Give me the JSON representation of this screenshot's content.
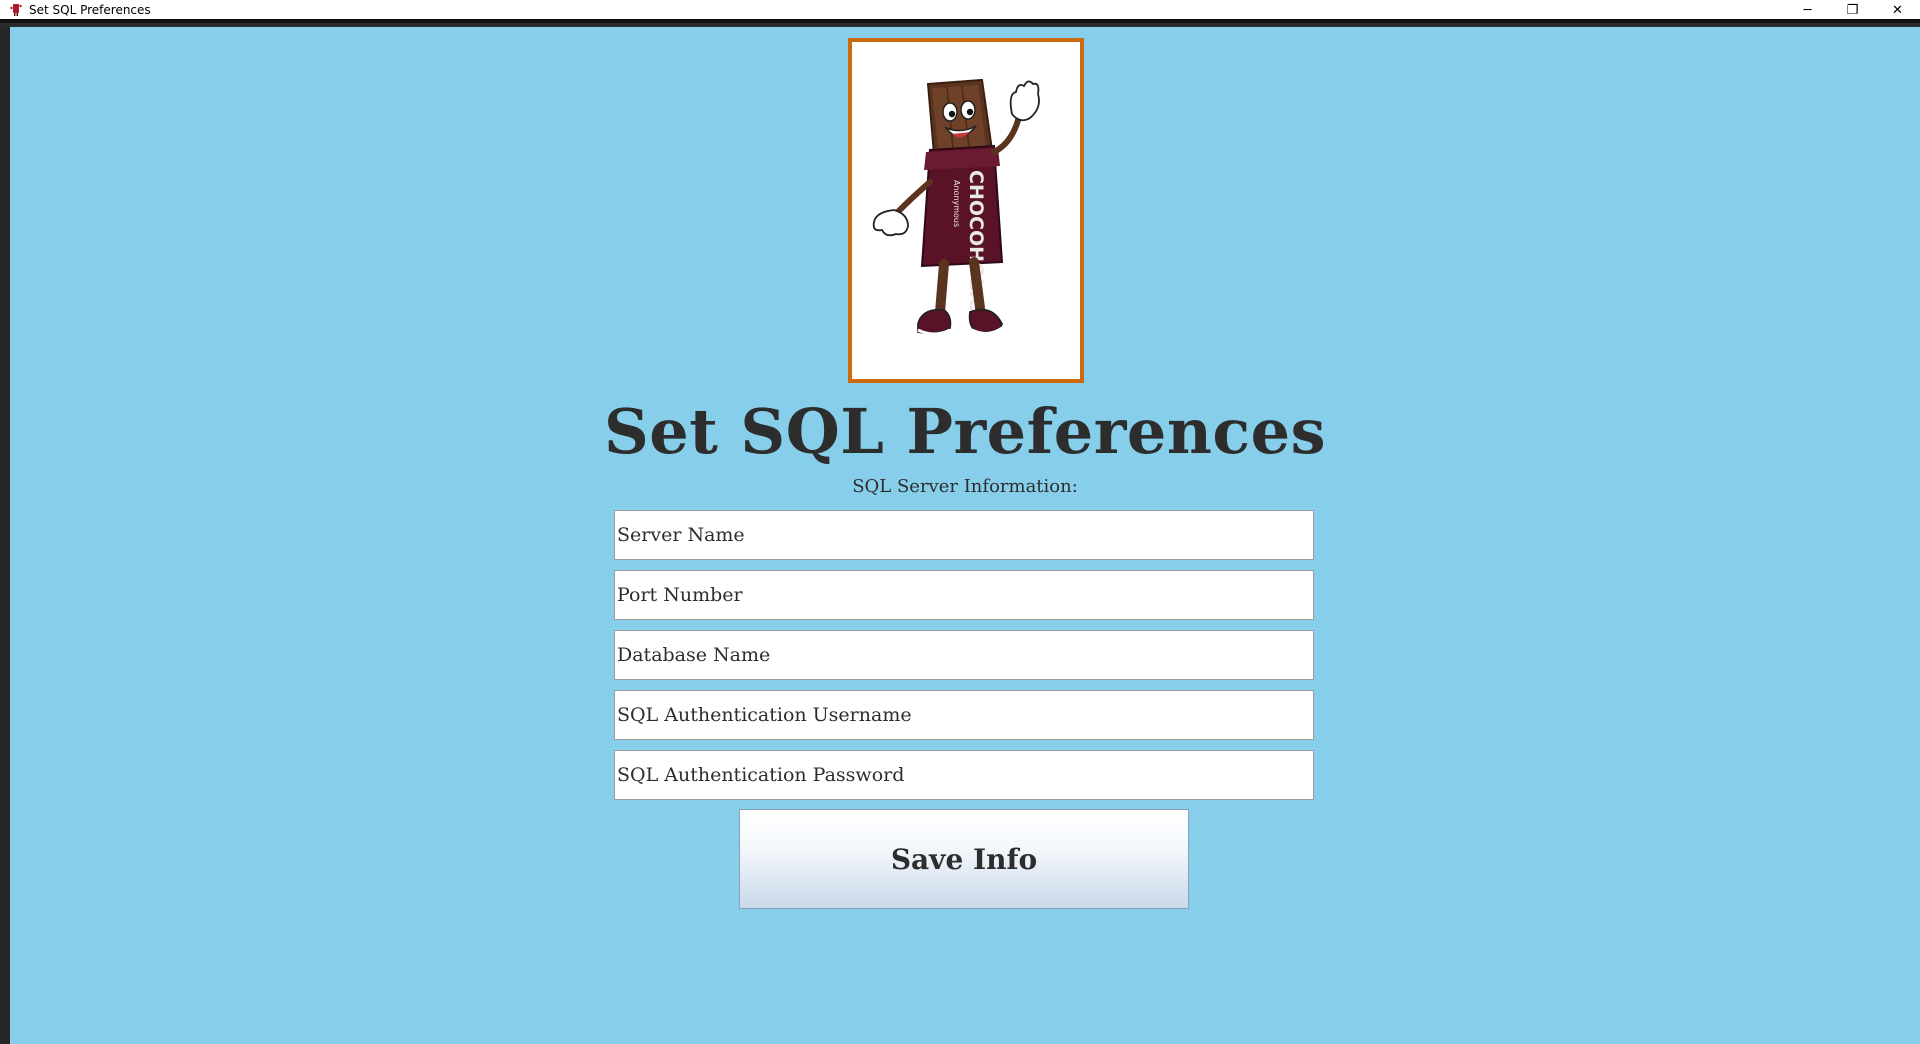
{
  "window": {
    "title": "Set SQL Preferences",
    "controls": {
      "minimize": "─",
      "restore": "❐",
      "close": "✕"
    }
  },
  "logo": {
    "icon": "chocolate-bar-mascot",
    "wrapper_text": "CHOCOHOLICS",
    "wrapper_subtext": "Anonymous"
  },
  "page": {
    "title": "Set SQL Preferences",
    "subtitle": "SQL Server Information:"
  },
  "form": {
    "server_name": {
      "value": "",
      "placeholder": "Server Name"
    },
    "port_number": {
      "value": "",
      "placeholder": "Port Number"
    },
    "database_name": {
      "value": "",
      "placeholder": "Database Name"
    },
    "sql_username": {
      "value": "",
      "placeholder": "SQL Authentication Username"
    },
    "sql_password": {
      "value": "",
      "placeholder": "SQL Authentication Password"
    }
  },
  "actions": {
    "save_label": "Save Info"
  },
  "colors": {
    "background": "#87ceeb",
    "logo_border": "#cc6a0e",
    "text": "#2d2d2d"
  }
}
